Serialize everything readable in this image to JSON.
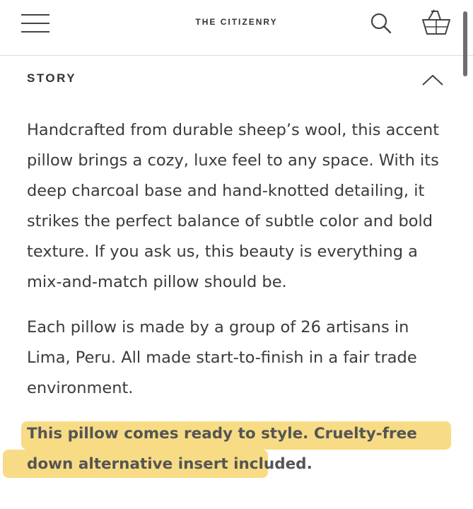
{
  "header": {
    "brand": "THE CITIZENRY",
    "menu_icon": "hamburger-menu-icon",
    "search_icon": "search-icon",
    "cart_icon": "shopping-basket-icon"
  },
  "section": {
    "title": "STORY",
    "toggle_icon": "chevron-up-icon",
    "expanded": true
  },
  "story": {
    "paragraphs": [
      "Handcrafted from durable sheep’s wool, this accent pillow brings a cozy, luxe feel to any space. With its deep charcoal base and hand-knotted detailing, it strikes the perfect balance of subtle color and bold texture. If you ask us, this beauty is everything a mix-and-match pillow should be.",
      "Each pillow is made by a group of 26 artisans in Lima, Peru. All made start-to-finish in a fair trade environment."
    ],
    "highlight": "This pillow comes ready to style. Cruelty-free down alternative insert included."
  },
  "colors": {
    "highlight": "#f7dc85",
    "text": "#3b3b3b",
    "divider": "#dcdcdc"
  }
}
